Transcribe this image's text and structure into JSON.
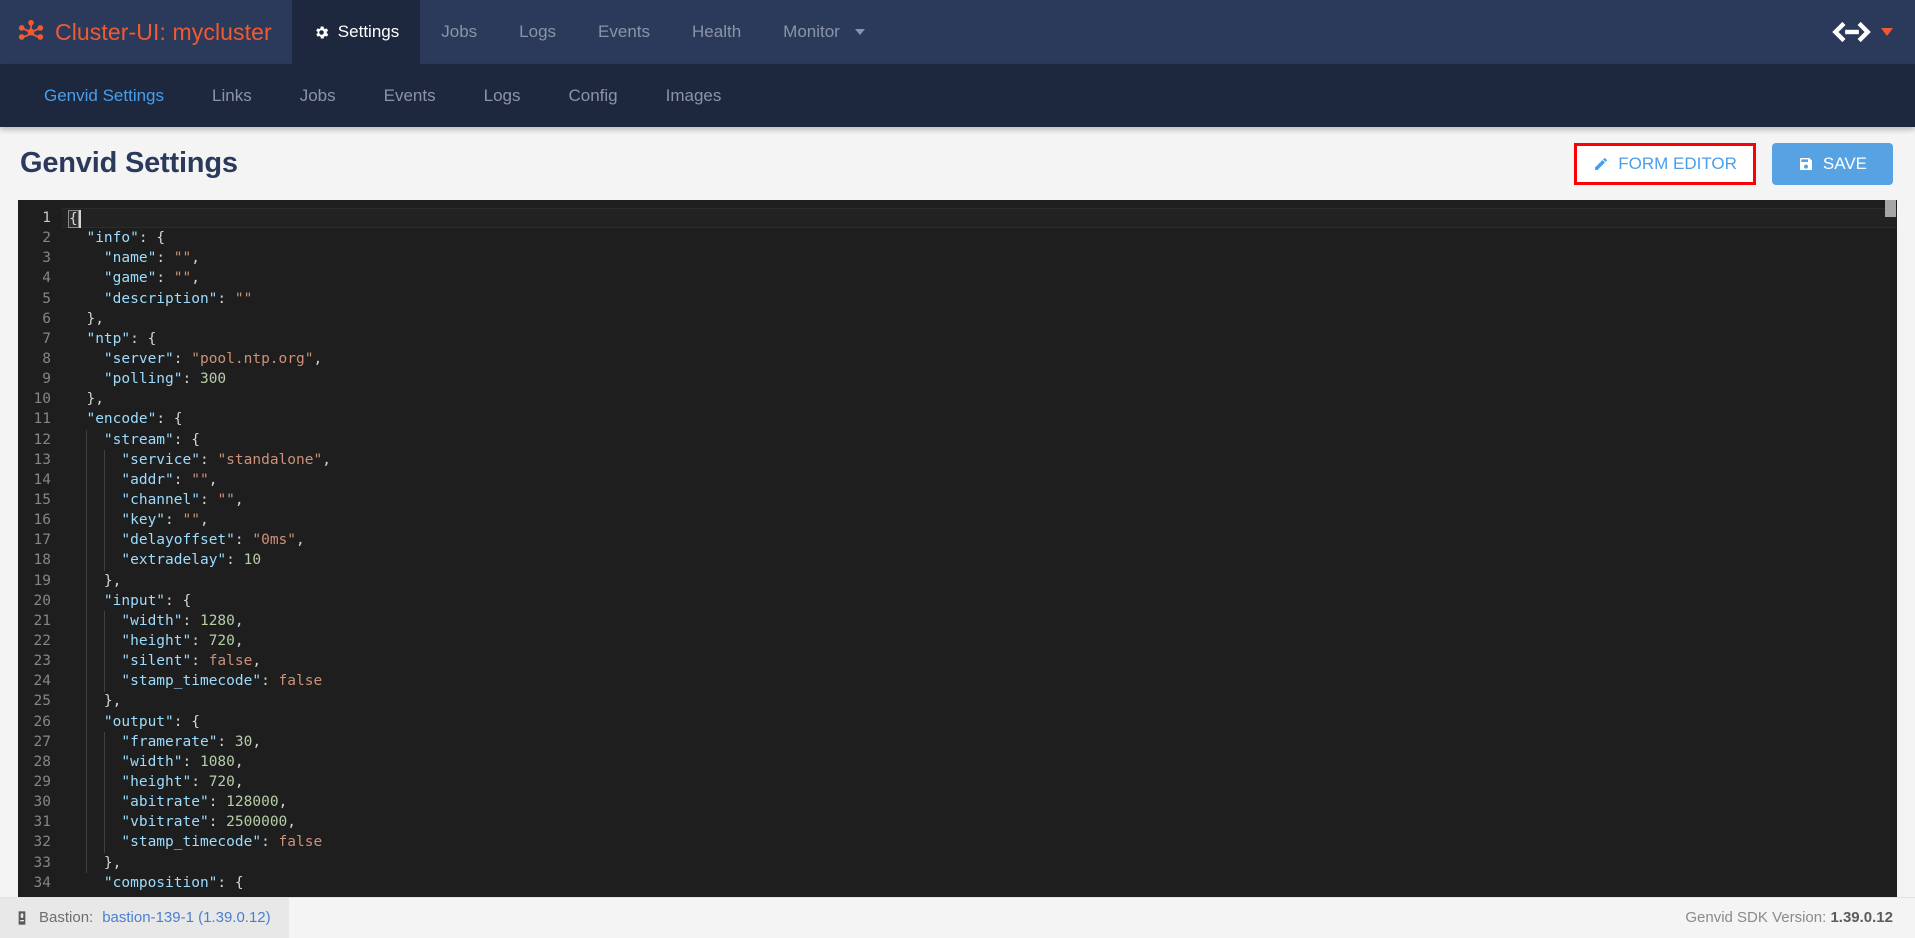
{
  "header": {
    "brand_label": "Cluster-UI: mycluster",
    "brand_icon": "cluster-hub-icon",
    "items": [
      {
        "label": "Settings",
        "icon": "gear-icon",
        "active": true
      },
      {
        "label": "Jobs",
        "active": false
      },
      {
        "label": "Logs",
        "active": false
      },
      {
        "label": "Events",
        "active": false
      },
      {
        "label": "Health",
        "active": false
      },
      {
        "label": "Monitor",
        "active": false,
        "dropdown": true
      }
    ],
    "logo_icon": "genvid-logo-icon",
    "logo_caret_icon": "caret-down-icon",
    "accent_orange": "#f05a32",
    "nav_bg": "#2b3a5b",
    "active_bg": "#1d283f"
  },
  "subnav": {
    "items": [
      {
        "label": "Genvid Settings",
        "active": true
      },
      {
        "label": "Links",
        "active": false
      },
      {
        "label": "Jobs",
        "active": false
      },
      {
        "label": "Events",
        "active": false
      },
      {
        "label": "Logs",
        "active": false
      },
      {
        "label": "Config",
        "active": false
      },
      {
        "label": "Images",
        "active": false
      }
    ],
    "active_color": "#4a9eea"
  },
  "page": {
    "title": "Genvid Settings",
    "form_editor_label": "FORM EDITOR",
    "form_editor_icon": "pencil-icon",
    "form_editor_highlight_color": "#fb0007",
    "save_label": "SAVE",
    "save_icon": "floppy-disk-icon",
    "save_color": "#56a2e3"
  },
  "editor": {
    "language": "json",
    "cursor_line": 1,
    "first_visible_line": 1,
    "last_visible_line": 34,
    "lines": [
      {
        "n": 1,
        "indent": 0,
        "tokens": [
          {
            "t": "{",
            "c": "p",
            "hl": true
          }
        ]
      },
      {
        "n": 2,
        "indent": 1,
        "tokens": [
          {
            "t": "\"info\"",
            "c": "k"
          },
          {
            "t": ": {",
            "c": "p"
          }
        ]
      },
      {
        "n": 3,
        "indent": 2,
        "tokens": [
          {
            "t": "\"name\"",
            "c": "k"
          },
          {
            "t": ": ",
            "c": "p"
          },
          {
            "t": "\"\"",
            "c": "s"
          },
          {
            "t": ",",
            "c": "p"
          }
        ]
      },
      {
        "n": 4,
        "indent": 2,
        "tokens": [
          {
            "t": "\"game\"",
            "c": "k"
          },
          {
            "t": ": ",
            "c": "p"
          },
          {
            "t": "\"\"",
            "c": "s"
          },
          {
            "t": ",",
            "c": "p"
          }
        ]
      },
      {
        "n": 5,
        "indent": 2,
        "tokens": [
          {
            "t": "\"description\"",
            "c": "k"
          },
          {
            "t": ": ",
            "c": "p"
          },
          {
            "t": "\"\"",
            "c": "s"
          }
        ]
      },
      {
        "n": 6,
        "indent": 1,
        "tokens": [
          {
            "t": "},",
            "c": "p"
          }
        ]
      },
      {
        "n": 7,
        "indent": 1,
        "tokens": [
          {
            "t": "\"ntp\"",
            "c": "k"
          },
          {
            "t": ": {",
            "c": "p"
          }
        ]
      },
      {
        "n": 8,
        "indent": 2,
        "tokens": [
          {
            "t": "\"server\"",
            "c": "k"
          },
          {
            "t": ": ",
            "c": "p"
          },
          {
            "t": "\"pool.ntp.org\"",
            "c": "s"
          },
          {
            "t": ",",
            "c": "p"
          }
        ]
      },
      {
        "n": 9,
        "indent": 2,
        "tokens": [
          {
            "t": "\"polling\"",
            "c": "k"
          },
          {
            "t": ": ",
            "c": "p"
          },
          {
            "t": "300",
            "c": "n"
          }
        ]
      },
      {
        "n": 10,
        "indent": 1,
        "tokens": [
          {
            "t": "},",
            "c": "p"
          }
        ]
      },
      {
        "n": 11,
        "indent": 1,
        "tokens": [
          {
            "t": "\"encode\"",
            "c": "k"
          },
          {
            "t": ": {",
            "c": "p"
          }
        ]
      },
      {
        "n": 12,
        "indent": 2,
        "tokens": [
          {
            "t": "\"stream\"",
            "c": "k"
          },
          {
            "t": ": {",
            "c": "p"
          }
        ]
      },
      {
        "n": 13,
        "indent": 3,
        "tokens": [
          {
            "t": "\"service\"",
            "c": "k"
          },
          {
            "t": ": ",
            "c": "p"
          },
          {
            "t": "\"standalone\"",
            "c": "s"
          },
          {
            "t": ",",
            "c": "p"
          }
        ]
      },
      {
        "n": 14,
        "indent": 3,
        "tokens": [
          {
            "t": "\"addr\"",
            "c": "k"
          },
          {
            "t": ": ",
            "c": "p"
          },
          {
            "t": "\"\"",
            "c": "s"
          },
          {
            "t": ",",
            "c": "p"
          }
        ]
      },
      {
        "n": 15,
        "indent": 3,
        "tokens": [
          {
            "t": "\"channel\"",
            "c": "k"
          },
          {
            "t": ": ",
            "c": "p"
          },
          {
            "t": "\"\"",
            "c": "s"
          },
          {
            "t": ",",
            "c": "p"
          }
        ]
      },
      {
        "n": 16,
        "indent": 3,
        "tokens": [
          {
            "t": "\"key\"",
            "c": "k"
          },
          {
            "t": ": ",
            "c": "p"
          },
          {
            "t": "\"\"",
            "c": "s"
          },
          {
            "t": ",",
            "c": "p"
          }
        ]
      },
      {
        "n": 17,
        "indent": 3,
        "tokens": [
          {
            "t": "\"delayoffset\"",
            "c": "k"
          },
          {
            "t": ": ",
            "c": "p"
          },
          {
            "t": "\"0ms\"",
            "c": "s"
          },
          {
            "t": ",",
            "c": "p"
          }
        ]
      },
      {
        "n": 18,
        "indent": 3,
        "tokens": [
          {
            "t": "\"extradelay\"",
            "c": "k"
          },
          {
            "t": ": ",
            "c": "p"
          },
          {
            "t": "10",
            "c": "n"
          }
        ]
      },
      {
        "n": 19,
        "indent": 2,
        "tokens": [
          {
            "t": "},",
            "c": "p"
          }
        ]
      },
      {
        "n": 20,
        "indent": 2,
        "tokens": [
          {
            "t": "\"input\"",
            "c": "k"
          },
          {
            "t": ": {",
            "c": "p"
          }
        ]
      },
      {
        "n": 21,
        "indent": 3,
        "tokens": [
          {
            "t": "\"width\"",
            "c": "k"
          },
          {
            "t": ": ",
            "c": "p"
          },
          {
            "t": "1280",
            "c": "n"
          },
          {
            "t": ",",
            "c": "p"
          }
        ]
      },
      {
        "n": 22,
        "indent": 3,
        "tokens": [
          {
            "t": "\"height\"",
            "c": "k"
          },
          {
            "t": ": ",
            "c": "p"
          },
          {
            "t": "720",
            "c": "n"
          },
          {
            "t": ",",
            "c": "p"
          }
        ]
      },
      {
        "n": 23,
        "indent": 3,
        "tokens": [
          {
            "t": "\"silent\"",
            "c": "k"
          },
          {
            "t": ": ",
            "c": "p"
          },
          {
            "t": "false",
            "c": "b"
          },
          {
            "t": ",",
            "c": "p"
          }
        ]
      },
      {
        "n": 24,
        "indent": 3,
        "tokens": [
          {
            "t": "\"stamp_timecode\"",
            "c": "k"
          },
          {
            "t": ": ",
            "c": "p"
          },
          {
            "t": "false",
            "c": "b"
          }
        ]
      },
      {
        "n": 25,
        "indent": 2,
        "tokens": [
          {
            "t": "},",
            "c": "p"
          }
        ]
      },
      {
        "n": 26,
        "indent": 2,
        "tokens": [
          {
            "t": "\"output\"",
            "c": "k"
          },
          {
            "t": ": {",
            "c": "p"
          }
        ]
      },
      {
        "n": 27,
        "indent": 3,
        "tokens": [
          {
            "t": "\"framerate\"",
            "c": "k"
          },
          {
            "t": ": ",
            "c": "p"
          },
          {
            "t": "30",
            "c": "n"
          },
          {
            "t": ",",
            "c": "p"
          }
        ]
      },
      {
        "n": 28,
        "indent": 3,
        "tokens": [
          {
            "t": "\"width\"",
            "c": "k"
          },
          {
            "t": ": ",
            "c": "p"
          },
          {
            "t": "1080",
            "c": "n"
          },
          {
            "t": ",",
            "c": "p"
          }
        ]
      },
      {
        "n": 29,
        "indent": 3,
        "tokens": [
          {
            "t": "\"height\"",
            "c": "k"
          },
          {
            "t": ": ",
            "c": "p"
          },
          {
            "t": "720",
            "c": "n"
          },
          {
            "t": ",",
            "c": "p"
          }
        ]
      },
      {
        "n": 30,
        "indent": 3,
        "tokens": [
          {
            "t": "\"abitrate\"",
            "c": "k"
          },
          {
            "t": ": ",
            "c": "p"
          },
          {
            "t": "128000",
            "c": "n"
          },
          {
            "t": ",",
            "c": "p"
          }
        ]
      },
      {
        "n": 31,
        "indent": 3,
        "tokens": [
          {
            "t": "\"vbitrate\"",
            "c": "k"
          },
          {
            "t": ": ",
            "c": "p"
          },
          {
            "t": "2500000",
            "c": "n"
          },
          {
            "t": ",",
            "c": "p"
          }
        ]
      },
      {
        "n": 32,
        "indent": 3,
        "tokens": [
          {
            "t": "\"stamp_timecode\"",
            "c": "k"
          },
          {
            "t": ": ",
            "c": "p"
          },
          {
            "t": "false",
            "c": "b"
          }
        ]
      },
      {
        "n": 33,
        "indent": 2,
        "tokens": [
          {
            "t": "},",
            "c": "p"
          }
        ]
      },
      {
        "n": 34,
        "indent": 2,
        "tokens": [
          {
            "t": "\"composition\"",
            "c": "k"
          },
          {
            "t": ": {",
            "c": "p"
          }
        ]
      }
    ],
    "colors": {
      "background": "#1e1e1e",
      "key": "#9cdcfe",
      "string": "#ce9178",
      "number": "#b5cea8",
      "punctuation": "#d4d4d4",
      "line_number": "#858585"
    }
  },
  "footer": {
    "bastion_label": "Bastion:",
    "bastion_icon": "bastion-host-icon",
    "bastion_link": "bastion-139-1 (1.39.0.12)",
    "sdk_label": "Genvid SDK Version:",
    "sdk_version": "1.39.0.12"
  }
}
